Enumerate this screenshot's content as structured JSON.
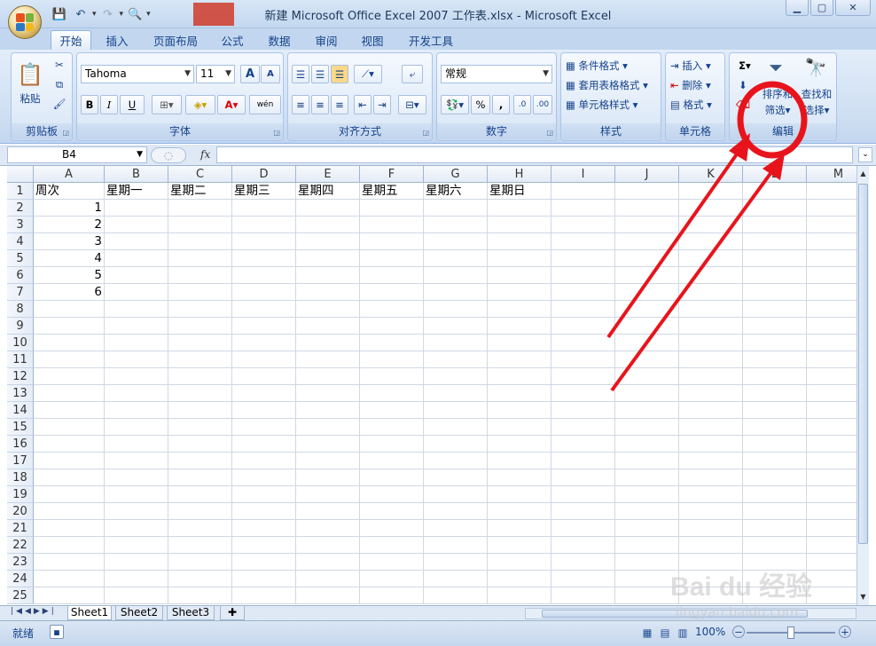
{
  "window": {
    "title": "新建 Microsoft Office Excel 2007 工作表.xlsx - Microsoft Excel",
    "controls": [
      "▭",
      "▢",
      "✕"
    ]
  },
  "quick_access": [
    "save-icon",
    "undo-icon",
    "redo-icon",
    "print-preview-icon"
  ],
  "tabs": [
    {
      "label": "开始",
      "active": true
    },
    {
      "label": "插入"
    },
    {
      "label": "页面布局"
    },
    {
      "label": "公式"
    },
    {
      "label": "数据"
    },
    {
      "label": "审阅"
    },
    {
      "label": "视图"
    },
    {
      "label": "开发工具"
    }
  ],
  "ribbon": {
    "clipboard": {
      "label": "剪贴板",
      "paste": "粘贴"
    },
    "font": {
      "label": "字体",
      "name": "Tahoma",
      "size": "11",
      "grow": "A",
      "shrink": "A",
      "bold": "B",
      "italic": "I",
      "underline": "U",
      "font_color": "A",
      "phonetic": "wén"
    },
    "alignment": {
      "label": "对齐方式"
    },
    "number": {
      "label": "数字",
      "format": "常规",
      "percent": "%",
      "comma": ","
    },
    "styles": {
      "label": "样式",
      "conditional": "条件格式",
      "table": "套用表格格式",
      "cell": "单元格样式"
    },
    "cells": {
      "label": "单元格",
      "insert": "插入",
      "delete": "删除",
      "format": "格式"
    },
    "editing": {
      "label": "编辑",
      "sort": "排序和",
      "sort2": "筛选",
      "find": "查找和",
      "find2": "选择",
      "sigma": "Σ"
    }
  },
  "formula_bar": {
    "name_box": "B4",
    "fx": "fx",
    "value": ""
  },
  "columns": [
    "A",
    "B",
    "C",
    "D",
    "E",
    "F",
    "G",
    "H",
    "I",
    "J",
    "K",
    "L",
    "M"
  ],
  "rows": [
    "1",
    "2",
    "3",
    "4",
    "5",
    "6",
    "7",
    "8",
    "9",
    "10",
    "11",
    "12",
    "13",
    "14",
    "15",
    "16",
    "17",
    "18",
    "19",
    "20",
    "21",
    "22",
    "23",
    "24",
    "25"
  ],
  "cells": {
    "r1": [
      "周次",
      "星期一",
      "星期二",
      "星期三",
      "星期四",
      "星期五",
      "星期六",
      "星期日"
    ],
    "colA": [
      "1",
      "2",
      "3",
      "4",
      "5",
      "6"
    ]
  },
  "sheets": [
    "Sheet1",
    "Sheet2",
    "Sheet3"
  ],
  "status": {
    "ready": "就绪",
    "zoom": "100%"
  },
  "watermark": {
    "brand": "Bai du 经验",
    "url": "jingyan.baidu.com"
  },
  "colors": {
    "annotation": "#e8141c",
    "accent": "#15428b"
  }
}
